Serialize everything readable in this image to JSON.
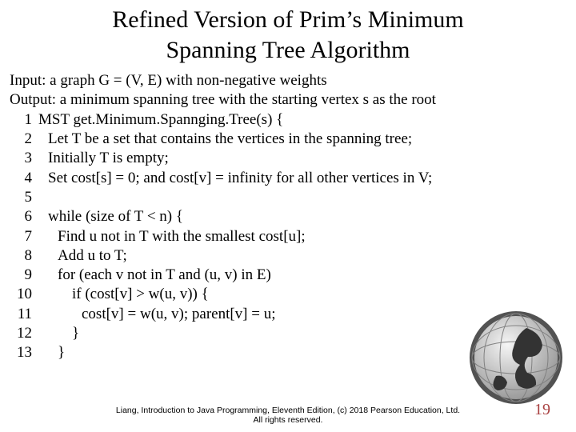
{
  "title_line1": "Refined Version of Prim’s Minimum",
  "title_line2": "Spanning Tree Algorithm",
  "input_line": "Input: a graph G = (V, E) with non-negative weights",
  "output_line": "Output: a minimum spanning tree with the starting vertex s as the root",
  "lines": {
    "l1": "MST get.Minimum.Spannging.Tree(s) {",
    "l2": "Let T be a set that contains the vertices in the spanning tree;",
    "l3": "Initially T is empty;",
    "l4": "Set cost[s] = 0; and cost[v] = infinity for all other vertices in V;",
    "l5": "",
    "l6": "while (size of T < n) {",
    "l7": "Find u not in T with the smallest cost[u];",
    "l8": "Add u to T;",
    "l9": "for (each v not in T and (u, v) in E)",
    "l10": "if (cost[v] > w(u, v)) {",
    "l11": "cost[v] = w(u, v); parent[v] = u;",
    "l12": "}",
    "l13": "}"
  },
  "nums": {
    "n1": "1",
    "n2": "2",
    "n3": "3",
    "n4": "4",
    "n5": "5",
    "n6": "6",
    "n7": "7",
    "n8": "8",
    "n9": "9",
    "n10": "10",
    "n11": "11",
    "n12": "12",
    "n13": "13"
  },
  "footer_line1": "Liang, Introduction to Java Programming, Eleventh Edition, (c) 2018 Pearson Education, Ltd.",
  "footer_line2": "All rights reserved.",
  "page_number": "19"
}
